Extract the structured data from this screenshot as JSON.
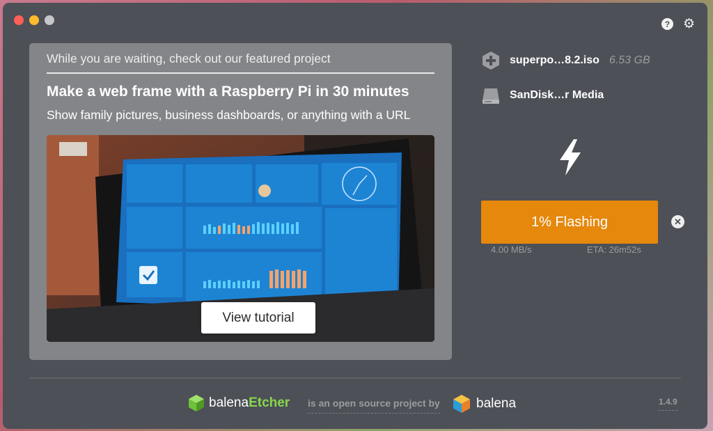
{
  "window": {
    "controls": [
      "close",
      "minimize",
      "maximize"
    ]
  },
  "toolbar": {
    "help_icon": "question-circle-icon",
    "settings_icon": "gear-icon"
  },
  "featured": {
    "header": "While you are waiting, check out our featured project",
    "title": "Make a web frame with a Raspberry Pi in 30 minutes",
    "subtitle": "Show family pictures, business dashboards, or anything with a URL",
    "button_label": "View tutorial"
  },
  "image": {
    "file_name": "superpo…8.2.iso",
    "file_size": "6.53 GB"
  },
  "drive": {
    "name": "SanDisk…r Media"
  },
  "flash": {
    "status_label": "1% Flashing",
    "progress": 0.01,
    "speed": "4.00 MB/s",
    "eta": "ETA: 26m52s"
  },
  "footer": {
    "brand_part1": "balena",
    "brand_part2": "Etcher",
    "tagline": "is an open source project by",
    "company": "balena",
    "version": "1.4.9"
  },
  "colors": {
    "window_bg": "#4d5057",
    "featured_bg": "#848588",
    "progress_orange": "#e5880c",
    "etcher_green": "#86d74d"
  }
}
